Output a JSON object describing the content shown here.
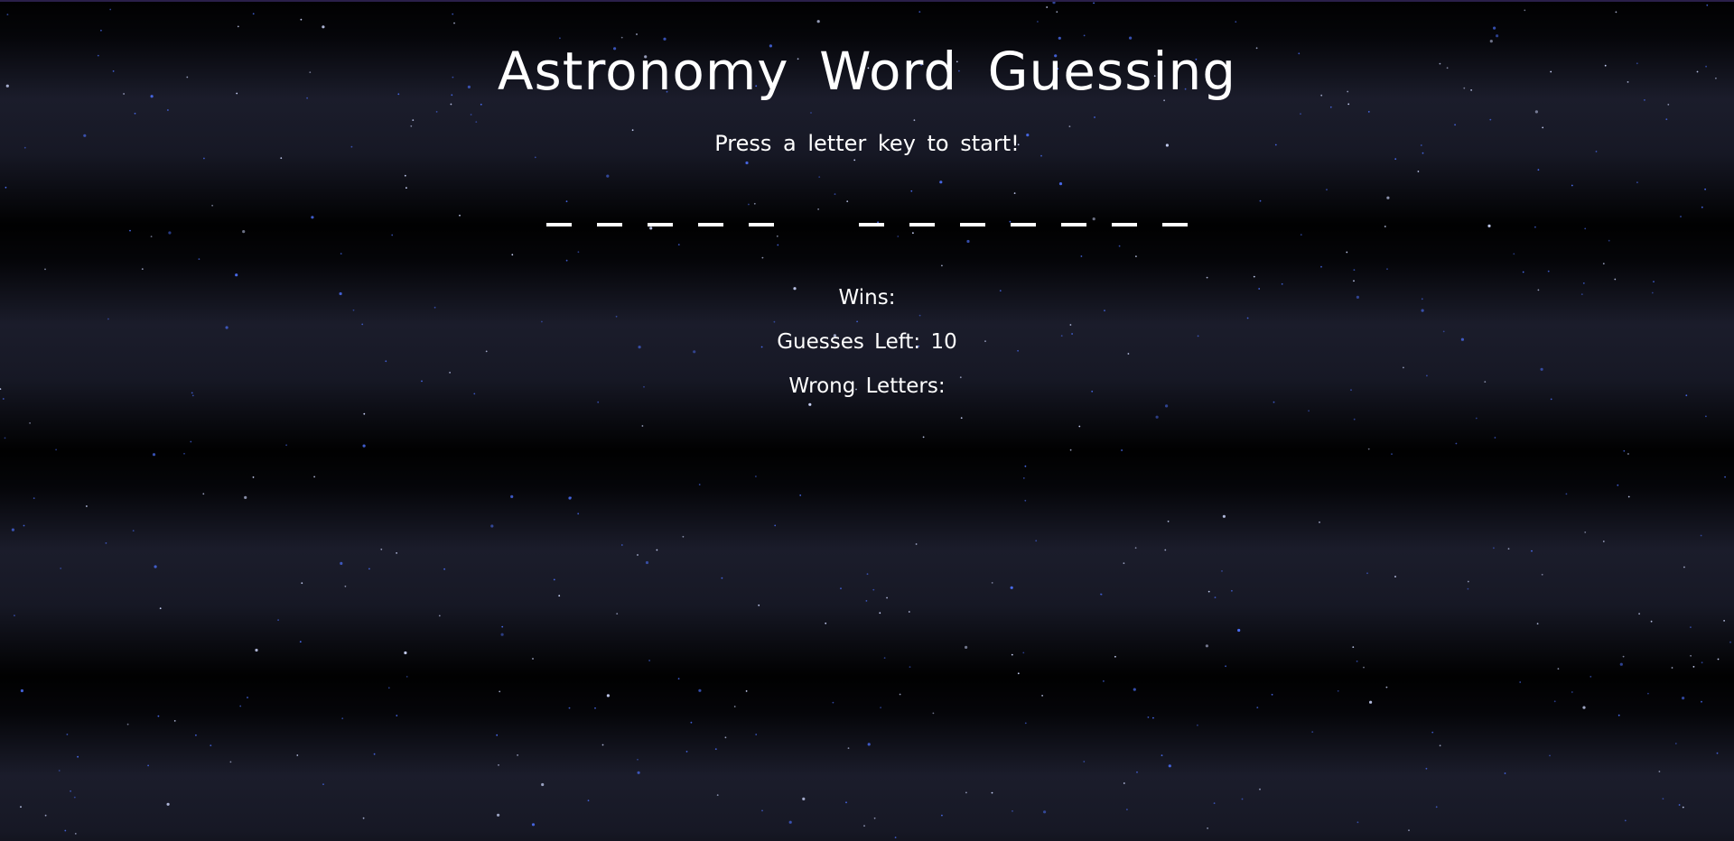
{
  "game": {
    "title": "Astronomy Word Guessing",
    "instructions": "Press a letter key to start!",
    "word_blanks": {
      "words": [
        {
          "letters": [
            "_",
            "_",
            "_",
            "_",
            "_"
          ]
        },
        {
          "letters": [
            "_",
            "_",
            "_",
            "_",
            "_",
            "_",
            "_"
          ]
        }
      ]
    },
    "wins_label": "Wins:",
    "wins_value": "",
    "guesses_left_label": "Guesses Left:",
    "guesses_left_value": "10",
    "wrong_letters_label": "Wrong Letters:",
    "wrong_letters_value": ""
  },
  "colors": {
    "text": "#ffffff",
    "background": "#05060a",
    "star": "#4a6cf0"
  }
}
